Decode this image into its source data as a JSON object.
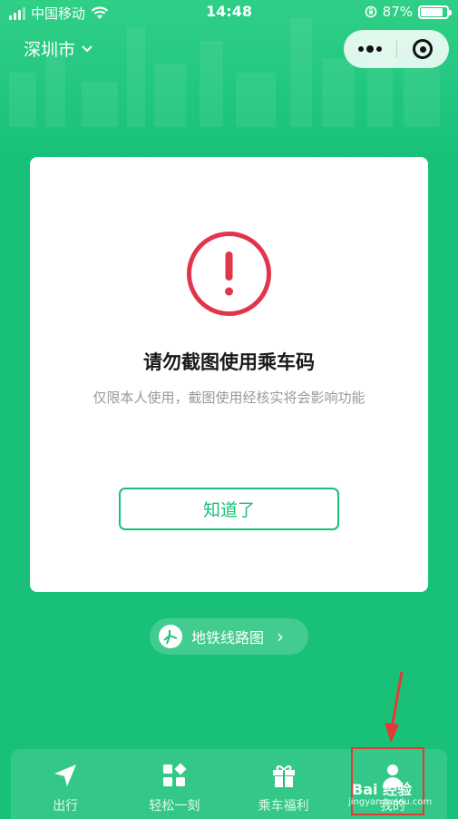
{
  "status_bar": {
    "carrier": "中国移动",
    "time": "14:48",
    "battery_percent": "87%",
    "battery_level": 0.87
  },
  "header": {
    "city": "深圳市",
    "more_icon": "more-dots-icon",
    "close_icon": "target-icon"
  },
  "modal": {
    "title": "请勿截图使用乘车码",
    "description": "仅限本人使用，截图使用经核实将会影响功能",
    "confirm_label": "知道了",
    "icon": "exclamation-circle-icon",
    "accent_color": "#e0354b"
  },
  "metro": {
    "label": "地铁线路图",
    "chevron": "›"
  },
  "tabs": [
    {
      "label": "出行",
      "icon": "navigation-arrow-icon"
    },
    {
      "label": "轻松一刻",
      "icon": "grid-diamond-icon"
    },
    {
      "label": "乘车福利",
      "icon": "gift-icon"
    },
    {
      "label": "我的",
      "icon": "user-icon"
    }
  ],
  "watermark": {
    "text": "Bai 经验",
    "sub": "jingyan.baidu.com"
  },
  "colors": {
    "brand_green": "#19c178",
    "warning_red": "#e0354b",
    "annotation_red": "#e53935"
  }
}
